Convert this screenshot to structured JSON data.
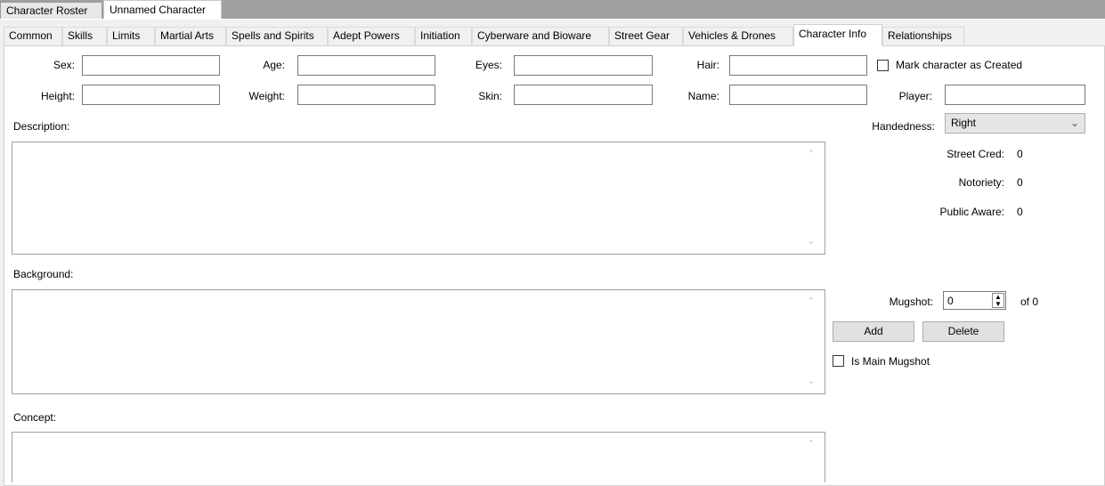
{
  "document_tabs": [
    "Character Roster",
    "Unnamed Character"
  ],
  "tabs": [
    "Common",
    "Skills",
    "Limits",
    "Martial Arts",
    "Spells and Spirits",
    "Adept Powers",
    "Initiation",
    "Cyberware and Bioware",
    "Street Gear",
    "Vehicles & Drones",
    "Character Info",
    "Relationships"
  ],
  "active_tab": "Character Info",
  "fields": {
    "sex": {
      "label": "Sex:",
      "value": ""
    },
    "age": {
      "label": "Age:",
      "value": ""
    },
    "eyes": {
      "label": "Eyes:",
      "value": ""
    },
    "hair": {
      "label": "Hair:",
      "value": ""
    },
    "height": {
      "label": "Height:",
      "value": ""
    },
    "weight": {
      "label": "Weight:",
      "value": ""
    },
    "skin": {
      "label": "Skin:",
      "value": ""
    },
    "name": {
      "label": "Name:",
      "value": ""
    },
    "player": {
      "label": "Player:",
      "value": ""
    }
  },
  "mark_created": {
    "label": "Mark character as Created",
    "checked": false
  },
  "handedness": {
    "label": "Handedness:",
    "value": "Right"
  },
  "stats": {
    "street_cred": {
      "label": "Street Cred:",
      "value": "0"
    },
    "notoriety": {
      "label": "Notoriety:",
      "value": "0"
    },
    "public_aware": {
      "label": "Public Aware:",
      "value": "0"
    }
  },
  "sections": {
    "description": "Description:",
    "background": "Background:",
    "concept": "Concept:"
  },
  "mugshot": {
    "label": "Mugshot:",
    "value": "0",
    "of_label": "of 0",
    "add_label": "Add",
    "delete_label": "Delete",
    "is_main_label": "Is Main Mugshot"
  }
}
